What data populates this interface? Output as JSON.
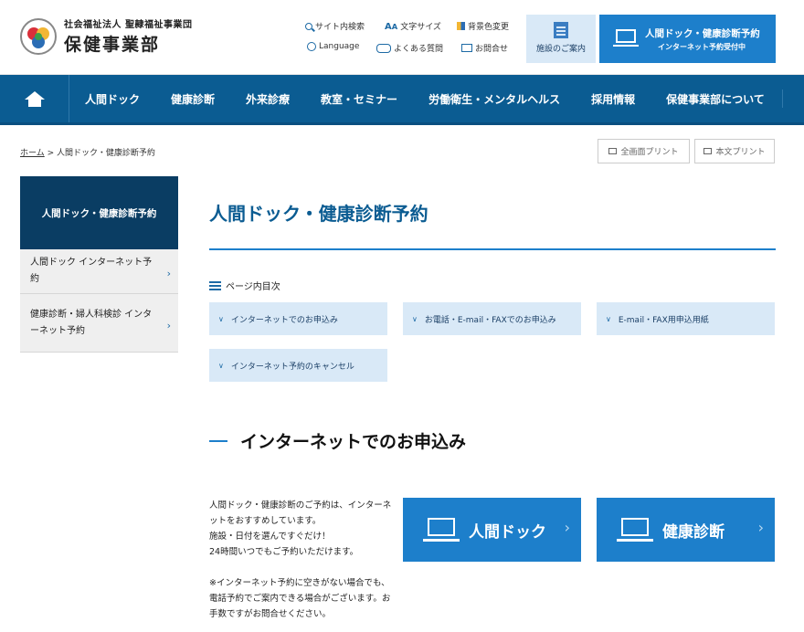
{
  "header": {
    "logo_sub": "社会福祉法人 聖隷福祉事業団",
    "logo_main": "保健事業部",
    "util": {
      "search": "サイト内検索",
      "font_size": "文字サイズ",
      "bg_color": "背景色変更",
      "language": "Language",
      "faq": "よくある質問",
      "contact": "お問合せ"
    },
    "facility": "施設のご案内",
    "reserve_title": "人間ドック・健康診断予約",
    "reserve_sub": "インターネット予約受付中"
  },
  "nav": {
    "items": [
      "人間ドック",
      "健康診断",
      "外来診療",
      "教室・セミナー",
      "労働衛生・メンタルヘルス",
      "採用情報",
      "保健事業部について"
    ]
  },
  "breadcrumb": {
    "home": "ホーム",
    "sep": " > ",
    "current": "人間ドック・健康診断予約"
  },
  "print": {
    "full": "全画面プリント",
    "body": "本文プリント"
  },
  "sidebar": {
    "head": "人間ドック・健康診断予約",
    "items": [
      {
        "label": "人間ドック インターネット予約"
      },
      {
        "label": "健康診断・婦人科検診 インターネット予約"
      }
    ]
  },
  "main": {
    "title": "人間ドック・健康診断予約",
    "toc_label": "ページ内目次",
    "toc": [
      "インターネットでのお申込み",
      "お電話・E-mail・FAXでのお申込み",
      "E-mail・FAX用申込用紙",
      "インターネット予約のキャンセル"
    ],
    "section_title": "インターネットでのお申込み",
    "body": [
      "人間ドック・健康診断のご予約は、インターネットをおすすめしています。",
      "施設・日付を選んですぐだけ！",
      "24時間いつでもご予約いただけます。",
      "※インターネット予約に空きがない場合でも、電話予約でご案内できる場合がございます。お手数ですがお問合せください。"
    ],
    "buttons": [
      "人間ドック",
      "健康診断"
    ]
  }
}
